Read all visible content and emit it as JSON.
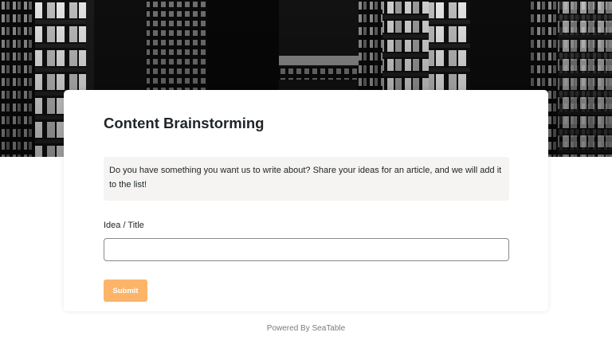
{
  "form": {
    "title": "Content Brainstorming",
    "description": "Do you have something you want us to write about? Share your ideas for an article, and we will add it to the list!",
    "fields": [
      {
        "label": "Idea / Title",
        "value": "",
        "placeholder": ""
      }
    ],
    "submit_label": "Submit"
  },
  "footer": {
    "text": "Powered By SeaTable"
  },
  "colors": {
    "accent": "#fcb469",
    "description_background": "#f5f4f2",
    "footer_text": "#7b7b7b"
  }
}
